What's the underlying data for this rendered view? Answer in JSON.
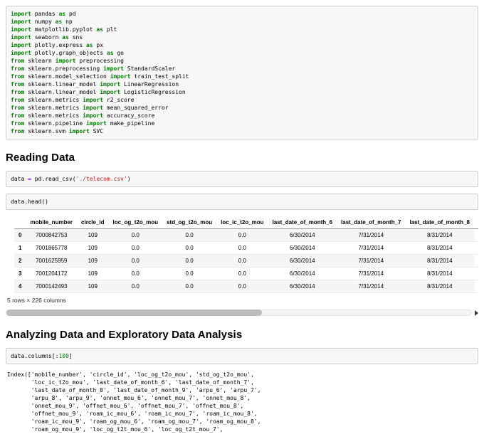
{
  "headings": {
    "reading": "Reading Data",
    "analyzing": "Analyzing Data and Exploratory Data Analysis"
  },
  "cells": {
    "imports": {
      "lines": [
        "import pandas as pd",
        "import numpy as np",
        "import matplotlib.pyplot as plt",
        "import seaborn as sns",
        "import plotly.express as px",
        "import plotly.graph_objects as go",
        "from sklearn import preprocessing",
        "from sklearn.preprocessing import StandardScaler",
        "from sklearn.model_selection import train_test_split",
        "from sklearn.linear_model import LinearRegression",
        "from sklearn.linear_model import LogisticRegression",
        "from sklearn.metrics import r2_score",
        "from sklearn.metrics import mean_squared_error",
        "from sklearn.metrics import accuracy_score",
        "from sklearn.pipeline import make_pipeline",
        "from sklearn.svm import SVC"
      ]
    },
    "read_csv": {
      "lines": [
        "data = pd.read_csv('./telecom.csv')"
      ]
    },
    "head": {
      "lines": [
        "data.head()"
      ]
    },
    "columns": {
      "lines": [
        "data.columns[:100]"
      ]
    }
  },
  "dataframe": {
    "columns": [
      "",
      "mobile_number",
      "circle_id",
      "loc_og_t2o_mou",
      "std_og_t2o_mou",
      "loc_ic_t2o_mou",
      "last_date_of_month_6",
      "last_date_of_month_7",
      "last_date_of_month_8",
      "last_date_of_month_9"
    ],
    "rows": [
      [
        "0",
        "7000842753",
        "109",
        "0.0",
        "0.0",
        "0.0",
        "6/30/2014",
        "7/31/2014",
        "8/31/2014"
      ],
      [
        "1",
        "7001865778",
        "109",
        "0.0",
        "0.0",
        "0.0",
        "6/30/2014",
        "7/31/2014",
        "8/31/2014"
      ],
      [
        "2",
        "7001625959",
        "109",
        "0.0",
        "0.0",
        "0.0",
        "6/30/2014",
        "7/31/2014",
        "8/31/2014"
      ],
      [
        "3",
        "7001204172",
        "109",
        "0.0",
        "0.0",
        "0.0",
        "6/30/2014",
        "7/31/2014",
        "8/31/2014"
      ],
      [
        "4",
        "7000142493",
        "109",
        "0.0",
        "0.0",
        "0.0",
        "6/30/2014",
        "7/31/2014",
        "8/31/2014"
      ]
    ],
    "summary": "5 rows × 226 columns"
  },
  "outputs": {
    "columns_index": {
      "lines": [
        "Index(['mobile_number', 'circle_id', 'loc_og_t2o_mou', 'std_og_t2o_mou',",
        "       'loc_ic_t2o_mou', 'last_date_of_month_6', 'last_date_of_month_7',",
        "       'last_date_of_month_8', 'last_date_of_month_9', 'arpu_6', 'arpu_7',",
        "       'arpu_8', 'arpu_9', 'onnet_mou_6', 'onnet_mou_7', 'onnet_mou_8',",
        "       'onnet_mou_9', 'offnet_mou_6', 'offnet_mou_7', 'offnet_mou_8',",
        "       'offnet_mou_9', 'roam_ic_mou_6', 'roam_ic_mou_7', 'roam_ic_mou_8',",
        "       'roam_ic_mou_9', 'roam_og_mou_6', 'roam_og_mou_7', 'roam_og_mou_8',",
        "       'roam_og_mou_9', 'loc_og_t2t_mou_6', 'loc_og_t2t_mou_7',"
      ]
    }
  },
  "colors": {
    "keyword": "#008000",
    "string": "#BA2121",
    "operator": "#AA22FF",
    "number": "#008000",
    "cell_background": "#f7f7f7",
    "cell_border": "#cfcfcf",
    "table_stripe": "#f5f5f5"
  },
  "scrollbar": {
    "thumb_fraction": 0.55
  }
}
